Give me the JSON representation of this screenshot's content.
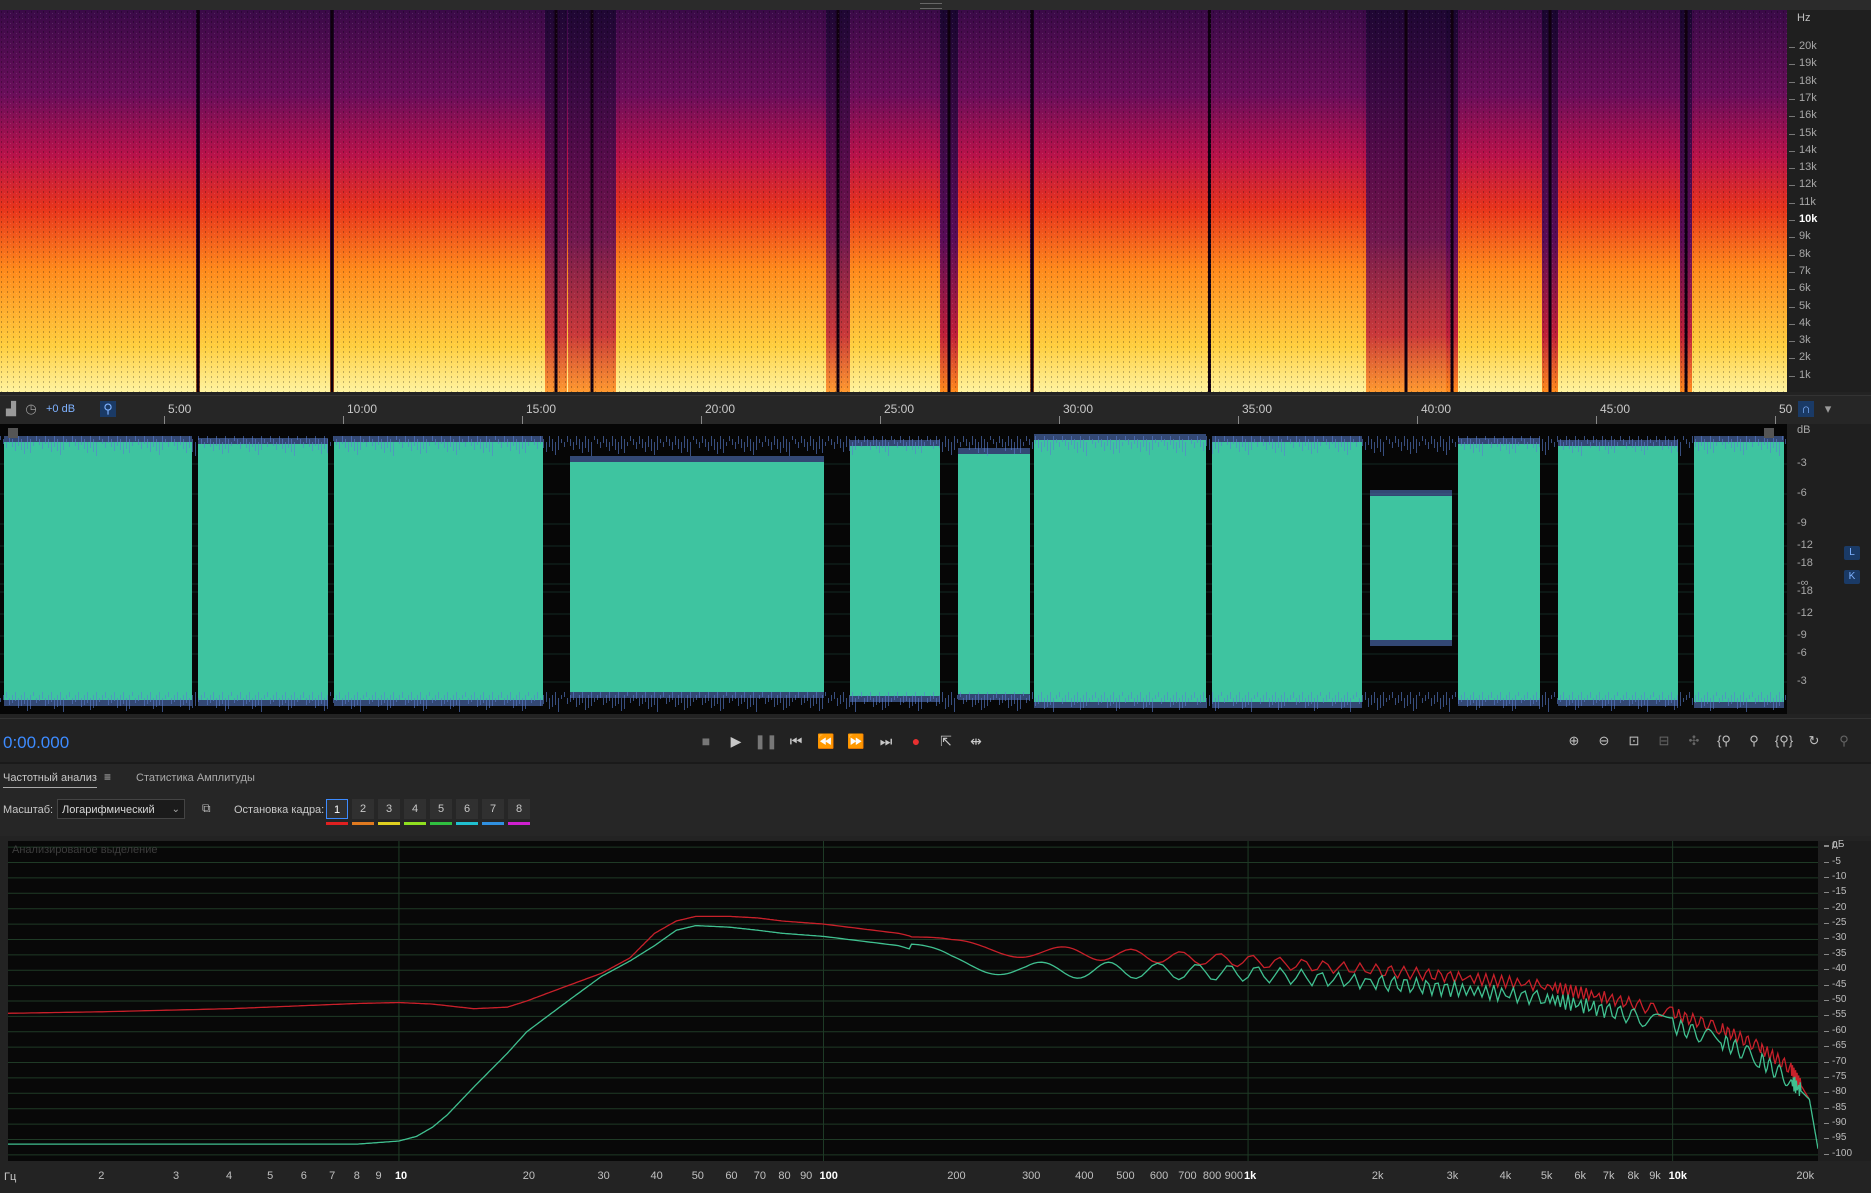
{
  "spectral_view": {
    "hz_unit": "Hz",
    "hz_ticks": [
      "20k",
      "19k",
      "18k",
      "17k",
      "16k",
      "15k",
      "14k",
      "13k",
      "12k",
      "11k",
      "10k",
      "9k",
      "8k",
      "7k",
      "6k",
      "5k",
      "4k",
      "3k",
      "2k",
      "1k"
    ]
  },
  "timeline": {
    "level": "+0 dB",
    "ticks": [
      "5:00",
      "10:00",
      "15:00",
      "20:00",
      "25:00",
      "30:00",
      "35:00",
      "40:00",
      "45:00",
      "50"
    ]
  },
  "waveform_view": {
    "db_unit": "dB",
    "db_ticks": [
      "-3",
      "-6",
      "-9",
      "-12",
      "-18",
      "-∞",
      "-18",
      "-12",
      "-9",
      "-6",
      "-3"
    ],
    "channel_left": "L",
    "channel_right": "K",
    "colors": {
      "wave": "#3ec4a0",
      "wave_edge": "#5a7fd0",
      "background": "#060606"
    }
  },
  "transport": {
    "time": "0:00.000",
    "buttons": [
      "stop-icon",
      "play-icon",
      "pause-icon",
      "skip-to-start-icon",
      "rewind-icon",
      "fast-forward-icon",
      "skip-to-end-icon",
      "record-icon",
      "loop-icon",
      "skip-selection-icon"
    ],
    "zoom_buttons": [
      "zoom-in-amplitude-icon",
      "zoom-out-amplitude-icon",
      "zoom-full-icon",
      "zoom-selection-icon",
      "zoom-in-point-icon",
      "zoom-in-left-icon",
      "zoom-in-icon",
      "zoom-out-full-icon",
      "zoom-reset-icon",
      "zoom-out-disabled-icon"
    ]
  },
  "panel": {
    "tab_freq": "Частотный анализ",
    "tab_amp": "Статистика Амплитуды",
    "scale_label": "Масштаб:",
    "scale_value": "Логарифмический",
    "freeze_label": "Остановка кадра:",
    "frames": [
      {
        "label": "1",
        "color": "#e02020"
      },
      {
        "label": "2",
        "color": "#e07a20"
      },
      {
        "label": "3",
        "color": "#e0d020"
      },
      {
        "label": "4",
        "color": "#90e020"
      },
      {
        "label": "5",
        "color": "#30c040"
      },
      {
        "label": "6",
        "color": "#20c0d0"
      },
      {
        "label": "7",
        "color": "#3090e0"
      },
      {
        "label": "8",
        "color": "#d020d0"
      }
    ]
  },
  "analysis": {
    "label": "Анализированое выделение",
    "db_unit": "дБ",
    "db_ticks": [
      "0",
      "-5",
      "-10",
      "-15",
      "-20",
      "-25",
      "-30",
      "-35",
      "-40",
      "-45",
      "-50",
      "-55",
      "-60",
      "-65",
      "-70",
      "-75",
      "-80",
      "-85",
      "-90",
      "-95",
      "-100"
    ],
    "hz_unit": "Гц",
    "hz_ticks": [
      {
        "label": "2",
        "hz": 2
      },
      {
        "label": "3",
        "hz": 3
      },
      {
        "label": "4",
        "hz": 4
      },
      {
        "label": "5",
        "hz": 5
      },
      {
        "label": "6",
        "hz": 6
      },
      {
        "label": "7",
        "hz": 7
      },
      {
        "label": "8",
        "hz": 8
      },
      {
        "label": "9",
        "hz": 9
      },
      {
        "label": "10",
        "hz": 10,
        "major": true
      },
      {
        "label": "20",
        "hz": 20
      },
      {
        "label": "30",
        "hz": 30
      },
      {
        "label": "40",
        "hz": 40
      },
      {
        "label": "50",
        "hz": 50
      },
      {
        "label": "60",
        "hz": 60
      },
      {
        "label": "70",
        "hz": 70
      },
      {
        "label": "80",
        "hz": 80
      },
      {
        "label": "90",
        "hz": 90
      },
      {
        "label": "100",
        "hz": 100,
        "major": true
      },
      {
        "label": "200",
        "hz": 200
      },
      {
        "label": "300",
        "hz": 300
      },
      {
        "label": "400",
        "hz": 400
      },
      {
        "label": "500",
        "hz": 500
      },
      {
        "label": "600",
        "hz": 600
      },
      {
        "label": "700",
        "hz": 700
      },
      {
        "label": "800",
        "hz": 800
      },
      {
        "label": "900",
        "hz": 900
      },
      {
        "label": "1k",
        "hz": 1000,
        "major": true
      },
      {
        "label": "2k",
        "hz": 2000
      },
      {
        "label": "3k",
        "hz": 3000
      },
      {
        "label": "4k",
        "hz": 4000
      },
      {
        "label": "5k",
        "hz": 5000
      },
      {
        "label": "6k",
        "hz": 6000
      },
      {
        "label": "7k",
        "hz": 7000
      },
      {
        "label": "8k",
        "hz": 8000
      },
      {
        "label": "9k",
        "hz": 9000
      },
      {
        "label": "10k",
        "hz": 10000,
        "major": true
      },
      {
        "label": "20k",
        "hz": 20000
      }
    ]
  },
  "chart_data": {
    "type": "line",
    "x_scale": "log",
    "xlim": [
      1.2,
      22000
    ],
    "ylim": [
      -102,
      2
    ],
    "xlabel": "Гц",
    "ylabel": "дБ",
    "grid": true,
    "series": [
      {
        "color": "#c8202a",
        "x": [
          1.2,
          2,
          4,
          6,
          8,
          10,
          12,
          15,
          18,
          20,
          25,
          30,
          35,
          40,
          45,
          50,
          60,
          70,
          80,
          100,
          150,
          200,
          300,
          500,
          1000,
          2000,
          3000,
          5000,
          7000,
          10000,
          13000,
          16000,
          19000,
          21000
        ],
        "y": [
          -54,
          -53.5,
          -52.5,
          -51.5,
          -50.8,
          -50.5,
          -51,
          -52.5,
          -52,
          -50,
          -45,
          -41,
          -36,
          -28,
          -24,
          -22.5,
          -22.5,
          -23,
          -24,
          -25,
          -28,
          -32,
          -34,
          -35,
          -37,
          -40,
          -42,
          -45,
          -49,
          -54,
          -59,
          -65,
          -72,
          -82
        ]
      },
      {
        "color": "#40c090",
        "x": [
          1.2,
          2,
          4,
          6,
          8,
          10,
          11,
          12,
          13,
          15,
          18,
          20,
          25,
          30,
          35,
          40,
          45,
          50,
          60,
          70,
          80,
          100,
          150,
          200,
          300,
          500,
          1000,
          2000,
          3000,
          5000,
          7000,
          10000,
          13000,
          16000,
          19000,
          21000,
          22000
        ],
        "y": [
          -96.5,
          -96.5,
          -96.5,
          -96.5,
          -96.5,
          -95.5,
          -94,
          -91,
          -87,
          -78,
          -67,
          -60,
          -50,
          -42,
          -37,
          -32,
          -27,
          -25.5,
          -26,
          -27,
          -28,
          -29,
          -32,
          -37,
          -40,
          -40,
          -41,
          -44,
          -46,
          -49,
          -53,
          -58,
          -63,
          -69,
          -76,
          -82,
          -98
        ]
      }
    ]
  }
}
